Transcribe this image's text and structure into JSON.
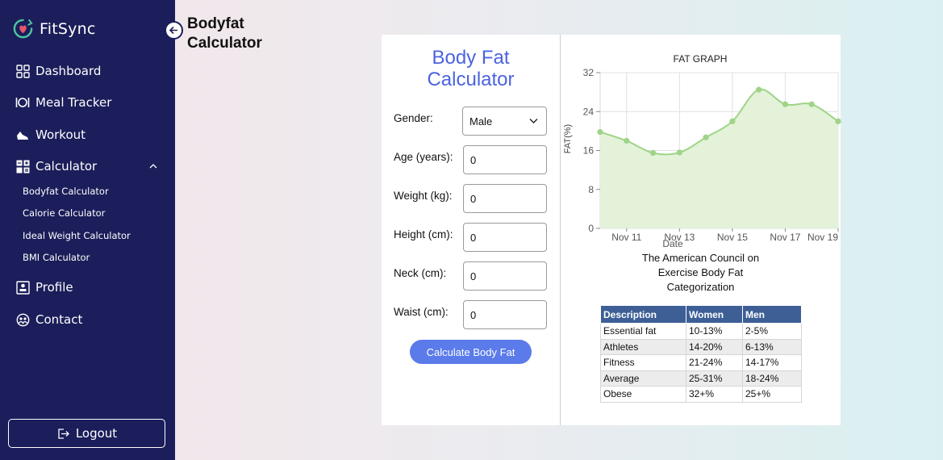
{
  "app": {
    "name": "FitSync"
  },
  "page_title_line1": "Bodyfat",
  "page_title_line2": "Calculator",
  "sidebar": {
    "items": [
      {
        "label": "Dashboard",
        "icon": "grid-icon"
      },
      {
        "label": "Meal Tracker",
        "icon": "plate-icon"
      },
      {
        "label": "Workout",
        "icon": "shoe-icon"
      },
      {
        "label": "Calculator",
        "icon": "calculator-icon",
        "expanded": true
      },
      {
        "label": "Profile",
        "icon": "profile-icon"
      },
      {
        "label": "Contact",
        "icon": "contact-icon"
      }
    ],
    "calculator_sub": [
      "Bodyfat Calculator",
      "Calorie Calculator",
      "Ideal Weight Calculator",
      "BMI Calculator"
    ],
    "logout_label": "Logout"
  },
  "calculator": {
    "title_line1": "Body Fat",
    "title_line2": "Calculator",
    "gender_label": "Gender:",
    "gender_value": "Male",
    "fields": [
      {
        "label": "Age (years):",
        "value": "0"
      },
      {
        "label": "Weight (kg):",
        "value": "0"
      },
      {
        "label": "Height (cm):",
        "value": "0"
      },
      {
        "label": "Neck (cm):",
        "value": "0"
      },
      {
        "label": "Waist (cm):",
        "value": "0"
      }
    ],
    "button_label": "Calculate Body Fat"
  },
  "chart_data": {
    "type": "area",
    "title": "FAT GRAPH",
    "xlabel": "Date",
    "ylabel": "FAT(%)",
    "x_ticks": [
      "Nov 11",
      "Nov 13",
      "Nov 15",
      "Nov 17",
      "Nov 19"
    ],
    "y_ticks": [
      0,
      8,
      16,
      24,
      32
    ],
    "ylim": [
      0,
      32
    ],
    "xlim": [
      "Nov 10",
      "Nov 19"
    ],
    "x": [
      "Nov 10",
      "Nov 11",
      "Nov 12",
      "Nov 13",
      "Nov 14",
      "Nov 15",
      "Nov 16",
      "Nov 17",
      "Nov 18",
      "Nov 19"
    ],
    "values": [
      19.8,
      18.0,
      15.5,
      15.6,
      18.7,
      22.0,
      28.5,
      25.5,
      25.5,
      22.0
    ],
    "grid": true,
    "colors": {
      "line": "#9fd487",
      "fill": "#e3f2d9",
      "point": "#9fd487"
    }
  },
  "ace": {
    "title": "The American Council on Exercise Body Fat Categorization",
    "headers": [
      "Description",
      "Women",
      "Men"
    ],
    "rows": [
      [
        "Essential fat",
        "10-13%",
        "2-5%"
      ],
      [
        "Athletes",
        "14-20%",
        "6-13%"
      ],
      [
        "Fitness",
        "21-24%",
        "14-17%"
      ],
      [
        "Average",
        "25-31%",
        "18-24%"
      ],
      [
        "Obese",
        "32+%",
        "25+%"
      ]
    ]
  }
}
